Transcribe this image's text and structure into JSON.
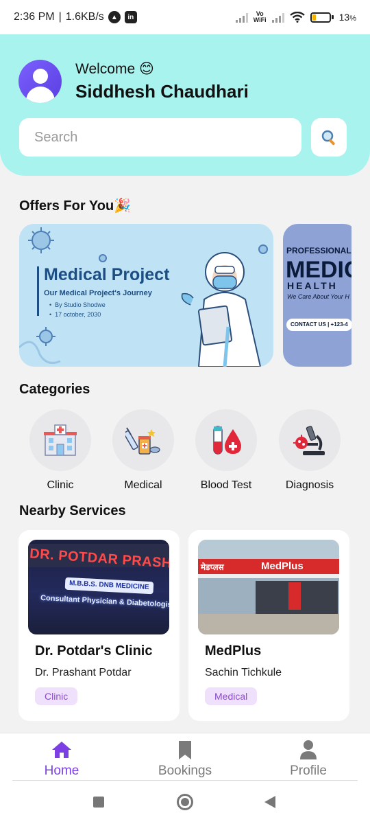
{
  "status_bar": {
    "time": "2:36 PM",
    "speed": "1.6KB/s",
    "battery": "13",
    "battery_unit": "%"
  },
  "header": {
    "welcome": "Welcome 😊",
    "user_name": "Siddhesh Chaudhari",
    "search_placeholder": "Search"
  },
  "offers": {
    "title": "Offers For You🎉",
    "card1": {
      "title": "Medical Project",
      "subtitle": "Our Medical Project's Journey",
      "bullet1": "By Studio Shodwe",
      "bullet2": "17 october, 2030"
    },
    "card2": {
      "top": "PROFESSIONAL",
      "big": "MEDIC",
      "health": "HEALTH",
      "tagline": "We Care About Your H",
      "contact": "CONTACT US  | +123-4"
    }
  },
  "categories": {
    "title": "Categories",
    "items": [
      {
        "label": "Clinic",
        "icon": "hospital-icon"
      },
      {
        "label": "Medical",
        "icon": "medicine-icon"
      },
      {
        "label": "Blood Test",
        "icon": "blood-test-icon"
      },
      {
        "label": "Diagnosis",
        "icon": "microscope-icon"
      }
    ]
  },
  "nearby": {
    "title": "Nearby Services",
    "services": [
      {
        "name": "Dr. Potdar's Clinic",
        "owner": "Dr. Prashant Potdar",
        "badge": "Clinic",
        "sign_line1": "DR. POTDAR PRASHANT",
        "sign_line2": "M.B.B.S. DNB MEDICINE",
        "sign_line3": "Consultant Physician & Diabetologist"
      },
      {
        "name": "MedPlus",
        "owner": "Sachin Tichkule",
        "badge": "Medical",
        "sign_marathi": "मेडप्लस",
        "sign_brand": "MedPlus"
      }
    ]
  },
  "bottom_nav": [
    {
      "label": "Home",
      "active": true
    },
    {
      "label": "Bookings",
      "active": false
    },
    {
      "label": "Profile",
      "active": false
    }
  ],
  "colors": {
    "header_bg": "#a8f3ee",
    "accent": "#7b3fe4",
    "badge_bg": "#efe0fb",
    "badge_text": "#8a4fc6"
  }
}
